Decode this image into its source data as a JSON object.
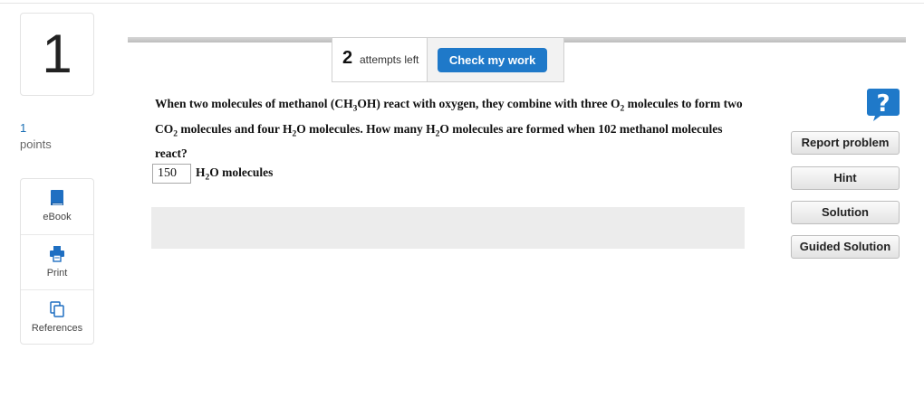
{
  "question": {
    "number": "1",
    "points_value": "1",
    "points_label": "points",
    "text_parts": {
      "p1": "When two molecules of methanol (CH",
      "p1_sub": "3",
      "p2": "OH) react with oxygen, they combine with three O",
      "p2_sub": "2",
      "p3": " molecules to form two CO",
      "p3_sub": "2",
      "p4": " molecules and four H",
      "p4_sub": "2",
      "p5": "O molecules. How many H",
      "p5_sub": "2",
      "p6": "O molecules are formed when 102 methanol molecules react?"
    }
  },
  "tools": {
    "ebook_label": "eBook",
    "print_label": "Print",
    "references_label": "References"
  },
  "toolbar": {
    "attempts_number": "2",
    "attempts_label": "attempts left",
    "check_label": "Check my work"
  },
  "answer": {
    "value": "150",
    "unit_pre": "H",
    "unit_sub": "2",
    "unit_post": "O molecules"
  },
  "sidebar": {
    "report_label": "Report problem",
    "hint_label": "Hint",
    "solution_label": "Solution",
    "guided_label": "Guided Solution"
  },
  "colors": {
    "accent": "#1f79c9",
    "points": "#1a6fb5",
    "feedback_bg": "#ececec"
  },
  "icons": [
    "ebook-icon",
    "print-icon",
    "references-icon",
    "help-icon"
  ]
}
